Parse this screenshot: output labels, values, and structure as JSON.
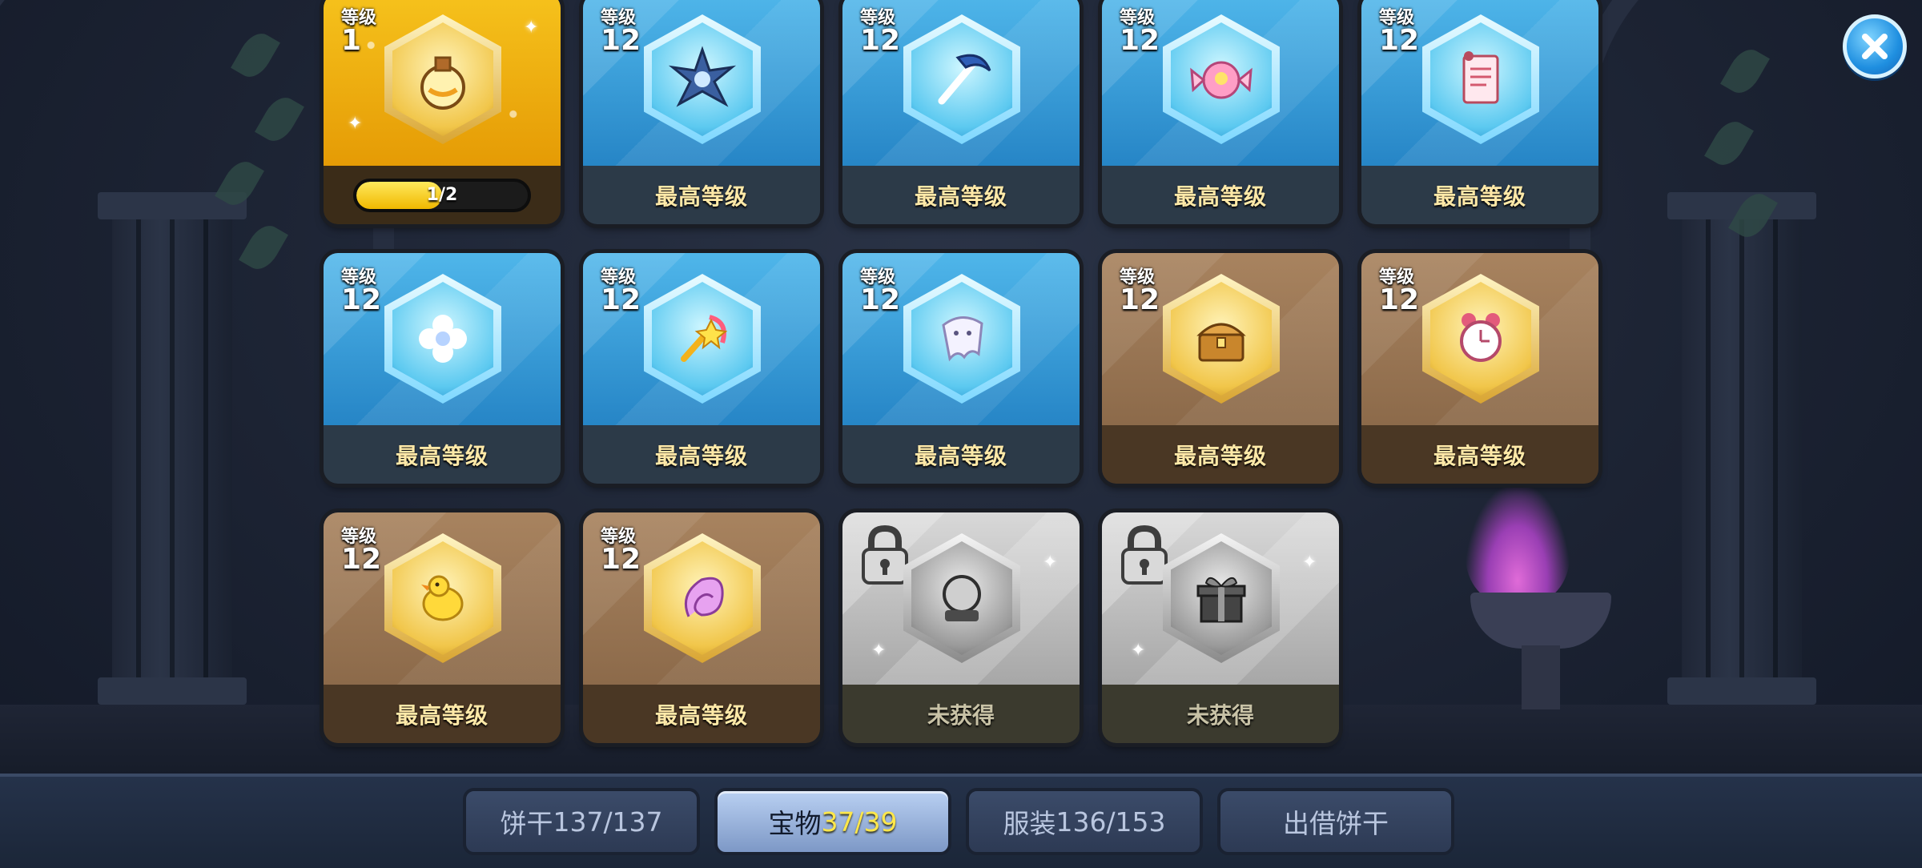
{
  "labels": {
    "level": "等级",
    "max_level": "最高等级",
    "unobtained": "未获得"
  },
  "treasures": [
    {
      "level": "1",
      "status": "progress",
      "progress_text": "1/2",
      "progress_fraction": 0.5,
      "rarity": "epic-gold",
      "icon": "potion-bottle-icon"
    },
    {
      "level": "12",
      "status": "max",
      "rarity": "rare-blue",
      "icon": "spiky-crystal-icon"
    },
    {
      "level": "12",
      "status": "max",
      "rarity": "rare-blue",
      "icon": "bone-scythe-icon"
    },
    {
      "level": "12",
      "status": "max",
      "rarity": "rare-blue",
      "icon": "pink-candy-icon"
    },
    {
      "level": "12",
      "status": "max",
      "rarity": "rare-blue",
      "icon": "scroll-note-icon"
    },
    {
      "level": "12",
      "status": "max",
      "rarity": "rare-blue",
      "icon": "white-flower-icon"
    },
    {
      "level": "12",
      "status": "max",
      "rarity": "rare-blue",
      "icon": "magic-wand-icon"
    },
    {
      "level": "12",
      "status": "max",
      "rarity": "rare-blue",
      "icon": "ghost-cloth-icon"
    },
    {
      "level": "12",
      "status": "max",
      "rarity": "common-brown",
      "icon": "treasure-chest-icon"
    },
    {
      "level": "12",
      "status": "max",
      "rarity": "common-brown",
      "icon": "alarm-clock-icon"
    },
    {
      "level": "12",
      "status": "max",
      "rarity": "common-brown",
      "icon": "yellow-chick-icon"
    },
    {
      "level": "12",
      "status": "max",
      "rarity": "common-brown",
      "icon": "pink-shell-icon"
    },
    {
      "status": "locked",
      "rarity": "locked-grey",
      "icon": "snow-globe-icon"
    },
    {
      "status": "locked",
      "rarity": "locked-grey",
      "icon": "gift-box-icon"
    }
  ],
  "tabs": [
    {
      "label": "饼干",
      "count": "137/137",
      "active": false
    },
    {
      "label": "宝物",
      "count": "37/39",
      "active": true
    },
    {
      "label": "服装",
      "count": "136/153",
      "active": false
    },
    {
      "label": "出借饼干",
      "count": "",
      "active": false
    }
  ],
  "colors": {
    "accent_yellow": "#ffe74a",
    "blue_card": "#2685c6",
    "brown_card": "#8c6a4a",
    "gold_card": "#f6c21c",
    "grey_card": "#a7a7a7"
  }
}
